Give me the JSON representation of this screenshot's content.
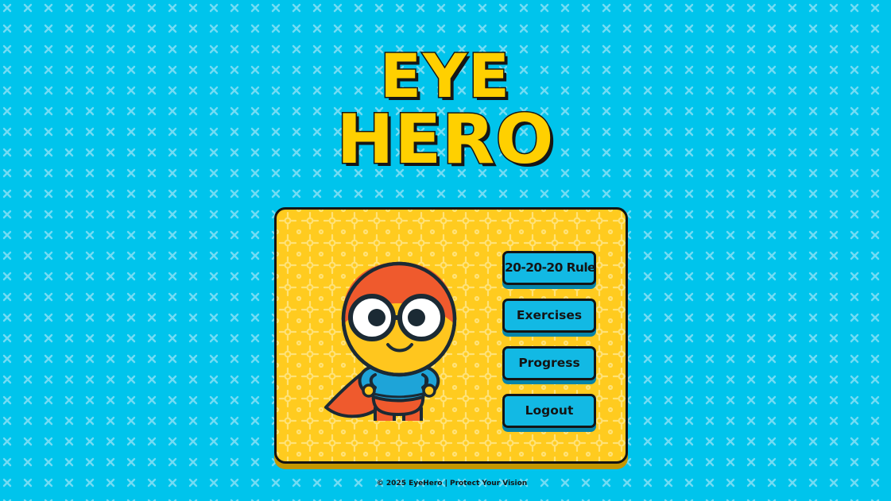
{
  "logo": {
    "line1": "EYE",
    "line2": "HERO"
  },
  "menu": {
    "items": [
      {
        "label": "20-20-20 Rule"
      },
      {
        "label": "Exercises"
      },
      {
        "label": "Progress"
      },
      {
        "label": "Logout"
      }
    ]
  },
  "mascot": {
    "icon": "superhero-mascot-icon"
  },
  "footer": {
    "text": "© 2025 EyeHero | Protect Your Vision"
  },
  "colors": {
    "background": "#00c4ec",
    "logo": "#ffd000",
    "card": "#ffcb1f",
    "button": "#12b9e4",
    "outline": "#141414",
    "hero_head": "#f0532a",
    "hero_suit": "#1ea4d8"
  }
}
